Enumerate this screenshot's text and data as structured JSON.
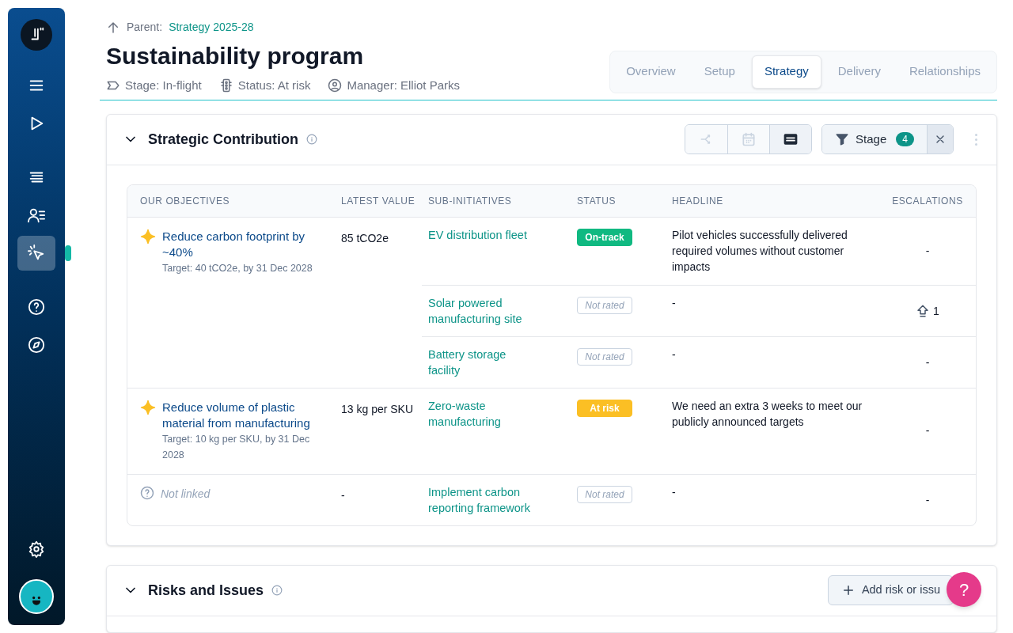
{
  "sidebar": {
    "groups": [
      {
        "items": [
          {
            "kind": "menu",
            "selected": false
          },
          {
            "kind": "play",
            "selected": false
          }
        ]
      },
      {
        "items": [
          {
            "kind": "list",
            "selected": false
          },
          {
            "kind": "people",
            "selected": false
          },
          {
            "kind": "pointer",
            "selected": true
          }
        ]
      },
      {
        "items": [
          {
            "kind": "help",
            "selected": false
          },
          {
            "kind": "compass",
            "selected": false
          }
        ]
      },
      {
        "items": [
          {
            "kind": "settings",
            "selected": false
          }
        ]
      }
    ]
  },
  "parent": {
    "label": "Parent:",
    "link": "Strategy 2025-28"
  },
  "title": "Sustainability program",
  "meta": [
    {
      "kind": "stage",
      "text": "Stage: In-flight"
    },
    {
      "kind": "status",
      "text": "Status: At risk"
    },
    {
      "kind": "manager",
      "text": "Manager: Elliot Parks"
    }
  ],
  "tabs": [
    {
      "label": "Overview",
      "selected": false
    },
    {
      "label": "Setup",
      "selected": false
    },
    {
      "label": "Strategy",
      "selected": true
    },
    {
      "label": "Delivery",
      "selected": false
    },
    {
      "label": "Relationships",
      "selected": false
    }
  ],
  "strategic_contribution": {
    "title": "Strategic Contribution",
    "expanded": true,
    "view_buttons": [
      {
        "kind": "tree",
        "selected": false
      },
      {
        "kind": "calendar",
        "selected": false
      },
      {
        "kind": "table",
        "selected": true
      }
    ],
    "filter": {
      "label": "Stage",
      "count": "4"
    },
    "table": {
      "columns": [
        "OUR OBJECTIVES",
        "LATEST VALUE",
        "SUB-INITIATIVES",
        "STATUS",
        "HEADLINE",
        "ESCALATIONS"
      ],
      "rows": [
        {
          "objective": {
            "kind": "objective",
            "name": "Reduce carbon footprint by ~40%",
            "target": "Target: 40 tCO2e, by 31 Dec 2028"
          },
          "latest_value": "85 tCO2e",
          "sub_initiatives": [
            {
              "name": "EV distribution fleet",
              "status": {
                "kind": "on_track",
                "label": "On-track"
              },
              "headline": "Pilot vehicles successfully delivered required volumes without customer impacts",
              "escalations": "-",
              "escalated": false
            },
            {
              "name": "Solar powered manufacturing site",
              "status": {
                "kind": "not_rated",
                "label": "Not rated"
              },
              "headline": "-",
              "escalations": "1",
              "escalated": true
            },
            {
              "name": "Battery storage facility",
              "status": {
                "kind": "not_rated",
                "label": "Not rated"
              },
              "headline": "-",
              "escalations": "-",
              "escalated": false
            }
          ]
        },
        {
          "objective": {
            "kind": "objective",
            "name": "Reduce volume of plastic material from manufacturing",
            "target": "Target: 10 kg per SKU, by 31 Dec 2028"
          },
          "latest_value": "13 kg per SKU",
          "sub_initiatives": [
            {
              "name": "Zero-waste manufacturing",
              "status": {
                "kind": "at_risk",
                "label": "At risk"
              },
              "headline": "We need an extra 3 weeks to meet our publicly announced targets",
              "escalations": "-",
              "escalated": false
            }
          ]
        },
        {
          "objective": {
            "kind": "unlinked",
            "name": "Not linked"
          },
          "latest_value": "-",
          "sub_initiatives": [
            {
              "name": "Implement carbon reporting framework",
              "status": {
                "kind": "not_rated",
                "label": "Not rated"
              },
              "headline": "-",
              "escalations": "-",
              "escalated": false
            }
          ]
        }
      ]
    }
  },
  "risks_and_issues": {
    "title": "Risks and Issues",
    "expanded": true,
    "add_button": "Add risk or issu"
  },
  "help_button": "?"
}
